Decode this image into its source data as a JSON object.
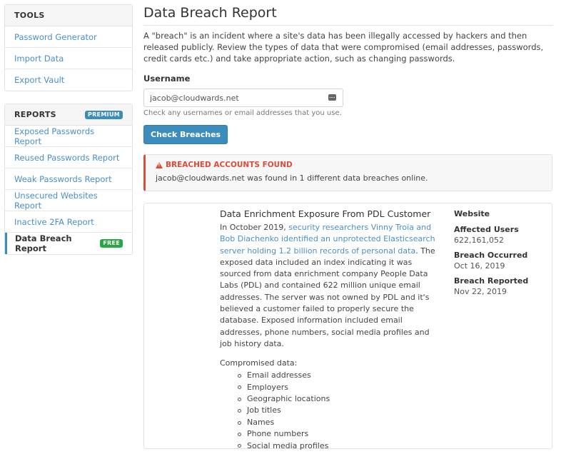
{
  "sidebar": {
    "tools": {
      "title": "TOOLS",
      "items": [
        {
          "label": "Password Generator"
        },
        {
          "label": "Import Data"
        },
        {
          "label": "Export Vault"
        }
      ]
    },
    "reports": {
      "title": "REPORTS",
      "badge": "PREMIUM",
      "items": [
        {
          "label": "Exposed Passwords Report"
        },
        {
          "label": "Reused Passwords Report"
        },
        {
          "label": "Weak Passwords Report"
        },
        {
          "label": "Unsecured Websites Report"
        },
        {
          "label": "Inactive 2FA Report"
        },
        {
          "label": "Data Breach Report",
          "badge": "FREE",
          "active": true
        }
      ]
    }
  },
  "main": {
    "title": "Data Breach Report",
    "intro": "A \"breach\" is an incident where a site's data has been illegally accessed by hackers and then released publicly. Review the types of data that were compromised (email addresses, passwords, credit cards etc.) and take appropriate action, such as changing passwords.",
    "username_label": "Username",
    "username_value": "jacob@cloudwards.net",
    "username_help": "Check any usernames or email addresses that you use.",
    "check_button": "Check Breaches",
    "alert": {
      "title": "BREACHED ACCOUNTS FOUND",
      "message": "jacob@cloudwards.net was found in 1 different data breaches online."
    },
    "breach": {
      "title": "Data Enrichment Exposure From PDL Customer",
      "desc_prefix": "In October 2019, ",
      "desc_link": "security researchers Vinny Troia and Bob Diachenko identified an unprotected Elasticsearch server holding 1.2 billion records of personal data",
      "desc_suffix": ". The exposed data included an index indicating it was sourced from data enrichment company People Data Labs (PDL) and contained 622 million unique email addresses. The server was not owned by PDL and it's believed a customer failed to properly secure the database. Exposed information included email addresses, phone numbers, social media profiles and job history data.",
      "compromised_label": "Compromised data:",
      "compromised": [
        "Email addresses",
        "Employers",
        "Geographic locations",
        "Job titles",
        "Names",
        "Phone numbers",
        "Social media profiles"
      ],
      "meta": {
        "website_label": "Website",
        "affected_label": "Affected Users",
        "affected_value": "622,161,052",
        "occurred_label": "Breach Occurred",
        "occurred_value": "Oct 16, 2019",
        "reported_label": "Breach Reported",
        "reported_value": "Nov 22, 2019"
      }
    }
  },
  "colors": {
    "accent": "#3c8dbc",
    "link": "#4b8fc8",
    "danger": "#dd4b39",
    "free_badge": "#28a745"
  }
}
